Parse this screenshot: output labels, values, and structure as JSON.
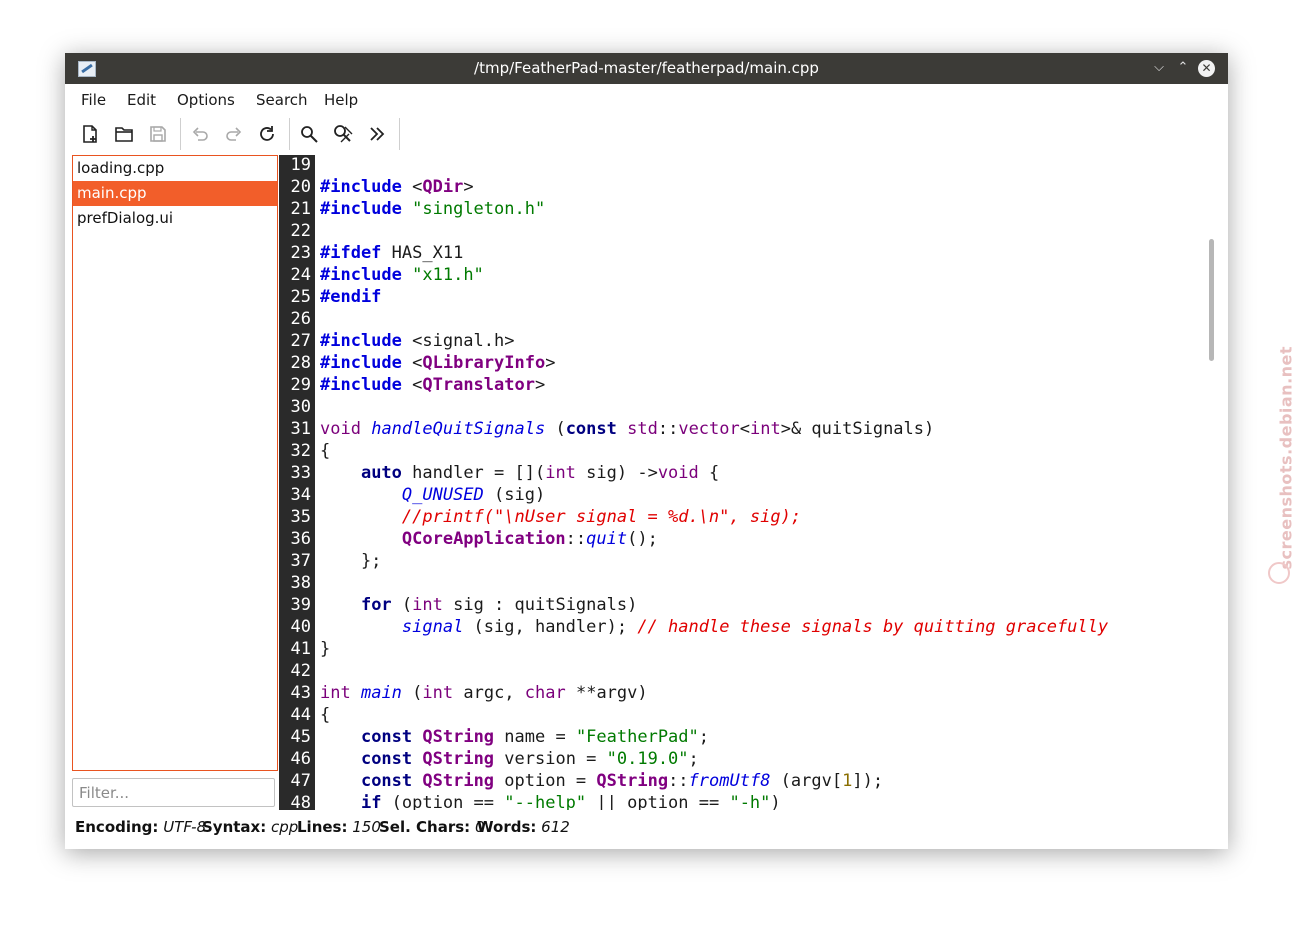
{
  "window": {
    "title": "/tmp/FeatherPad-master/featherpad/main.cpp"
  },
  "controls": {
    "minimize": "⌵",
    "maximize": "⌃",
    "close": "✕"
  },
  "menu": {
    "items": [
      "File",
      "Edit",
      "Options",
      "Search",
      "Help"
    ]
  },
  "toolbar": {
    "new_icon": "new-document-icon",
    "open_icon": "open-folder-icon",
    "save_icon": "save-icon",
    "undo_icon": "undo-icon",
    "redo_icon": "redo-icon",
    "reload_icon": "reload-icon",
    "find_icon": "find-icon",
    "replace_icon": "find-replace-icon",
    "goto_icon": "go-to-line-icon"
  },
  "sidebar": {
    "files": [
      "loading.cpp",
      "main.cpp",
      "prefDialog.ui"
    ],
    "selected": "main.cpp",
    "filter_placeholder": "Filter..."
  },
  "editor": {
    "line_numbers": [
      "19",
      "20",
      "21",
      "22",
      "23",
      "24",
      "25",
      "26",
      "27",
      "28",
      "29",
      "30",
      "31",
      "32",
      "33",
      "34",
      "35",
      "36",
      "37",
      "38",
      "39",
      "40",
      "41",
      "42",
      "43",
      "44",
      "45",
      "46",
      "47",
      "48"
    ]
  },
  "status": {
    "encoding_label": "Encoding:",
    "encoding": "UTF-8",
    "syntax_label": "Syntax:",
    "syntax": "cpp",
    "lines_label": "Lines:",
    "lines": "150",
    "selchars_label": "Sel. Chars:",
    "selchars": "0",
    "words_label": "Words:",
    "words": "612"
  },
  "watermark": {
    "text": "screenshots.debian.net"
  },
  "colors": {
    "accent": "#f25e2a",
    "titlebar": "#3c3b37",
    "gutter": "#2a2a2a"
  }
}
